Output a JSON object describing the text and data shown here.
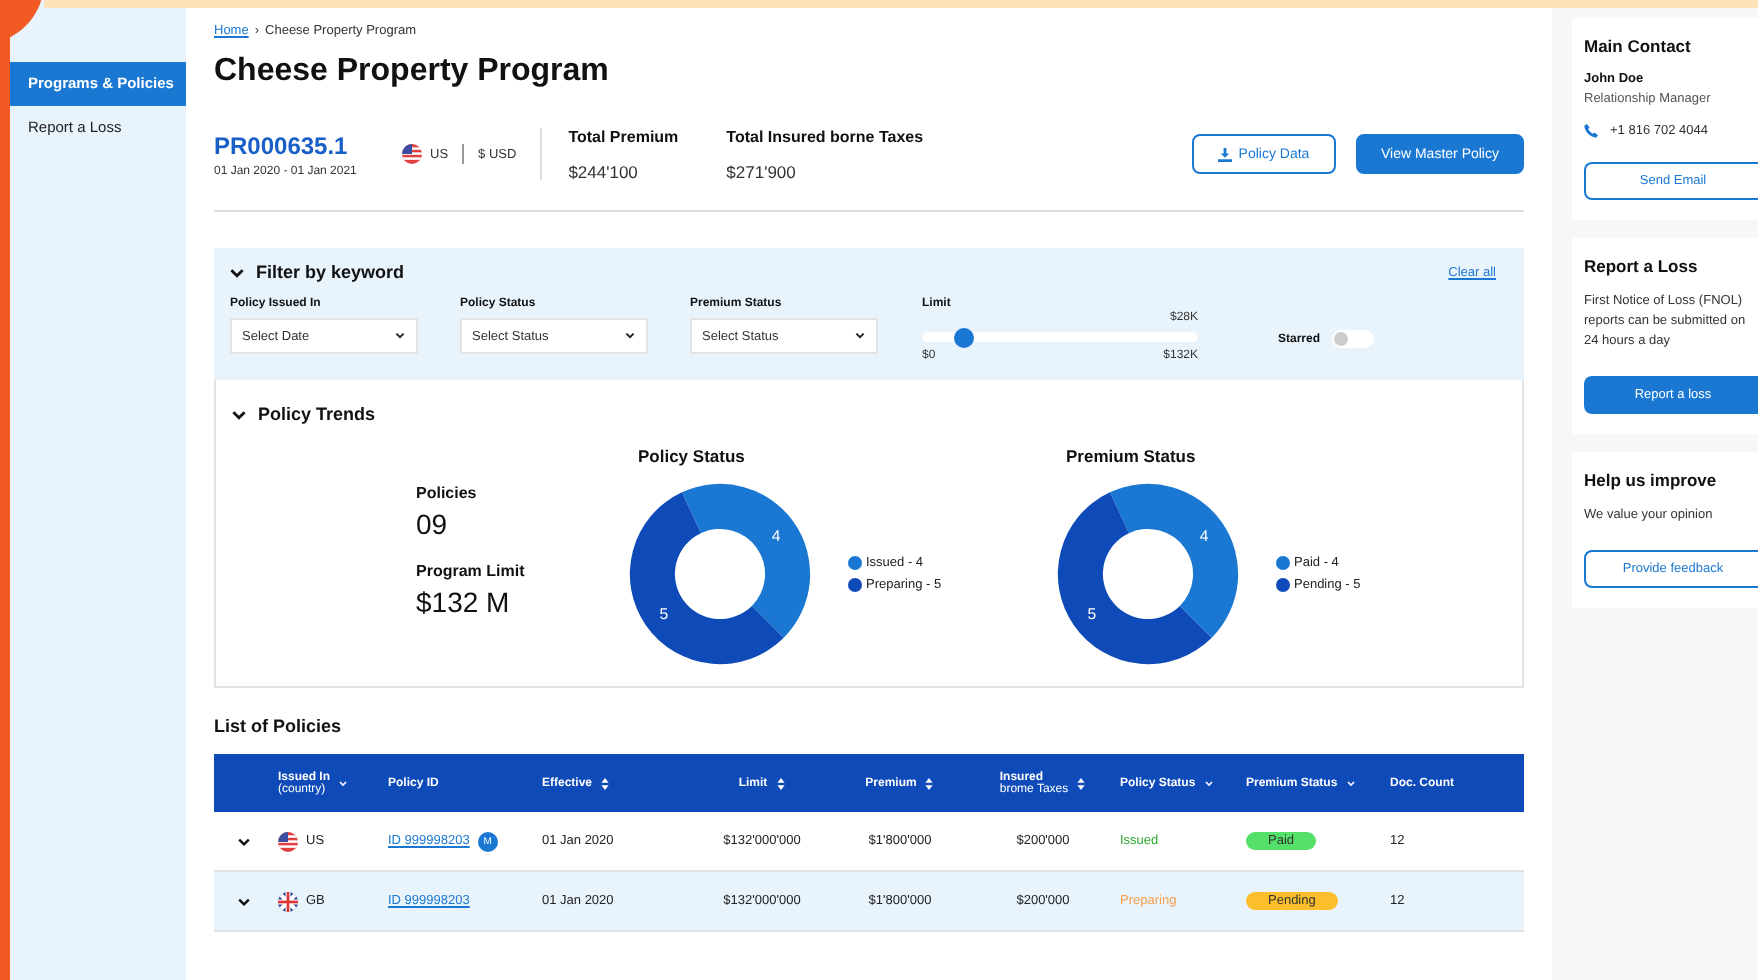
{
  "sidebar": {
    "items": [
      {
        "label": "Programs & Policies",
        "selected": true
      },
      {
        "label": "Report a Loss",
        "selected": false
      }
    ]
  },
  "breadcrumb": {
    "home": "Home",
    "separator": "›",
    "current": "Cheese Property Program"
  },
  "title": "Cheese Property Program",
  "program": {
    "id": "PR000635.1",
    "dates": "01 Jan 2020 - 01 Jan 2021",
    "country": "US",
    "currency": "$ USD",
    "stats": [
      {
        "label": "Total Premium",
        "value": "$244'100"
      },
      {
        "label": "Total Insured borne Taxes",
        "value": "$271'900"
      }
    ],
    "buttons": [
      {
        "label": "Policy Data",
        "kind": "outline"
      },
      {
        "label": "View Master Policy",
        "kind": "primary"
      }
    ]
  },
  "filter": {
    "title": "Filter by keyword",
    "expanded": true,
    "clear": "Clear all",
    "selects": [
      {
        "label": "Policy Issued In",
        "placeholder": "Select Date"
      },
      {
        "label": "Policy Status",
        "placeholder": "Select Status"
      },
      {
        "label": "Premium Status",
        "placeholder": "Select Status"
      }
    ],
    "limit": {
      "label": "Limit",
      "level": 0.15,
      "value": "$28K",
      "min": "$0",
      "max": "$132K"
    },
    "starred": {
      "label": "Starred",
      "on": false
    }
  },
  "trends": {
    "title": "Policy Trends",
    "expanded": true,
    "kpis": [
      {
        "label": "Policies",
        "value": "09"
      },
      {
        "label": "Program Limit",
        "value": "$132 M"
      }
    ],
    "charts": [
      {
        "legend": [
          {
            "label": "Issued - 4",
            "color": "#1a78d2"
          },
          {
            "label": "Preparing - 5",
            "color": "#0f4bb8"
          }
        ],
        "chart_data": {
          "type": "donut",
          "title": "Policy Status",
          "values": [
            4,
            5
          ],
          "data_labels": true
        }
      },
      {
        "legend": [
          {
            "label": "Paid - 4",
            "color": "#1a78d2"
          },
          {
            "label": "Pending - 5",
            "color": "#0f4bb8"
          }
        ],
        "chart_data": {
          "type": "donut",
          "title": "Premium Status",
          "values": [
            4,
            5
          ],
          "data_labels": true
        }
      }
    ]
  },
  "table": {
    "title": "List of Policies",
    "columns": [
      {
        "label": "Issued In",
        "sub": "(country)",
        "kind": "dropdown"
      },
      {
        "label": "Policy ID",
        "kind": "plain"
      },
      {
        "label": "Effective",
        "kind": "sortable"
      },
      {
        "label": "Limit",
        "kind": "sortable"
      },
      {
        "label": "Premium",
        "kind": "sortable"
      },
      {
        "label": "Insured",
        "sub": "brome Taxes",
        "kind": "sortable"
      },
      {
        "label": "Policy Status",
        "kind": "dropdown"
      },
      {
        "label": "Premium Status",
        "kind": "dropdown"
      },
      {
        "label": "Doc. Count",
        "kind": "plain"
      }
    ],
    "rows": [
      {
        "expanded": false,
        "selected": false,
        "kind": "us",
        "country": "US",
        "policy_id": "ID 999998203",
        "badge": "M",
        "effective": "01 Jan 2020",
        "limit": "$132'000'000",
        "premium": "$1'800'000",
        "taxes": "$200'000",
        "policy_status": {
          "label": "Issued",
          "color": "#2eaa2e"
        },
        "premium_status": {
          "label": "Paid",
          "color": "#55e06a"
        },
        "doc_count": "12"
      },
      {
        "expanded": false,
        "selected": true,
        "kind": "gb",
        "country": "GB",
        "policy_id": "ID 999998203",
        "effective": "01 Jan 2020",
        "limit": "$132'000'000",
        "premium": "$1'800'000",
        "taxes": "$200'000",
        "policy_status": {
          "label": "Preparing",
          "color": "#f5a04a"
        },
        "premium_status": {
          "label": "Pending",
          "color": "#fbbf2c"
        },
        "doc_count": "12"
      }
    ]
  },
  "contact": {
    "title": "Main Contact",
    "name": "John Doe",
    "role": "Relationship Manager",
    "phone": "+1 816 702 4044",
    "button": "Send Email"
  },
  "report": {
    "title": "Report a Loss",
    "text": "First Notice of Loss (FNOL) reports can be submitted on 24 hours a day",
    "button": "Report a loss"
  },
  "improve": {
    "title": "Help us improve",
    "text": "We value your opinion",
    "button": "Provide feedback"
  }
}
